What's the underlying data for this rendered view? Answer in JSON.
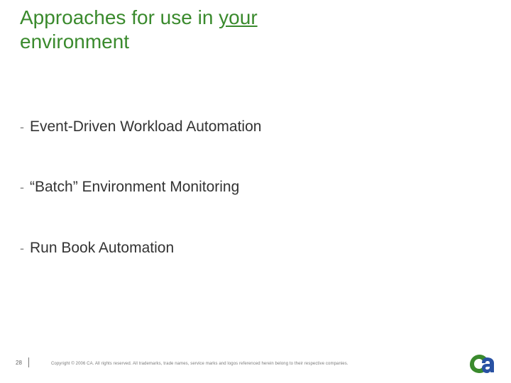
{
  "title": {
    "prefix": "Approaches for use in ",
    "underlined": "your",
    "suffix_line": "environment"
  },
  "bullets": [
    "Event-Driven Workload Automation",
    "“Batch” Environment Monitoring",
    "Run Book Automation"
  ],
  "footer": {
    "page_number": "28",
    "copyright": "Copyright © 2006 CA. All rights reserved. All trademarks, trade names, service marks and logos referenced herein belong to their respective companies."
  },
  "brand": {
    "logo_name": "ca",
    "colors": {
      "logo_c": "#3a8a2d",
      "logo_a": "#2952a3",
      "title": "#3a8a2d"
    }
  }
}
